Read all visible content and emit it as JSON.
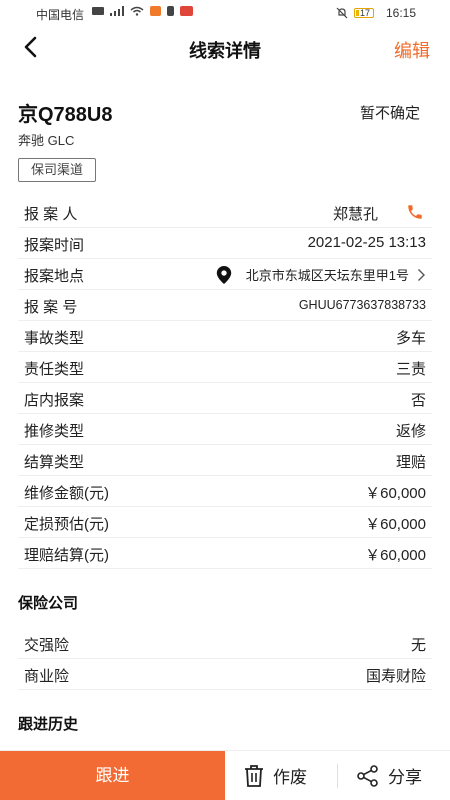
{
  "status_bar": {
    "carrier": "中国电信",
    "time": "16:15",
    "battery": "17",
    "battery_fraction": 0.17
  },
  "nav": {
    "back_icon": "chevron-left-icon",
    "title": "线索详情",
    "edit_label": "编辑"
  },
  "vehicle": {
    "plate": "京Q788U8",
    "status": "暂不确定",
    "model": "奔驰 GLC",
    "channel_tag": "保司渠道"
  },
  "details": {
    "reporter_label": "报 案 人",
    "reporter_value": "郑慧孔",
    "report_time_label": "报案时间",
    "report_time_value": "2021-02-25 13:13",
    "report_location_label": "报案地点",
    "report_location_value": "北京市东城区天坛东里甲1号",
    "report_number_label": "报 案 号",
    "report_number_value": "GHUU6773637838733",
    "accident_type_label": "事故类型",
    "accident_type_value": "多车",
    "liability_type_label": "责任类型",
    "liability_type_value": "三责",
    "in_store_label": "店内报案",
    "in_store_value": "否",
    "repair_type_label": "推修类型",
    "repair_type_value": "返修",
    "settlement_type_label": "结算类型",
    "settlement_type_value": "理赔",
    "repair_amount_label": "维修金额(元)",
    "repair_amount_value": "￥60,000",
    "loss_estimate_label": "定损预估(元)",
    "loss_estimate_value": "￥60,000",
    "claim_settlement_label": "理赔结算(元)",
    "claim_settlement_value": "￥60,000"
  },
  "insurance": {
    "section_title": "保险公司",
    "compulsory_label": "交强险",
    "compulsory_value": "无",
    "commercial_label": "商业险",
    "commercial_value": "国寿财险"
  },
  "history": {
    "section_title": "跟进历史"
  },
  "bottom_bar": {
    "follow_label": "跟进",
    "void_label": "作废",
    "share_label": "分享"
  },
  "colors": {
    "accent": "#f26b2b",
    "button": "#f26b35"
  }
}
